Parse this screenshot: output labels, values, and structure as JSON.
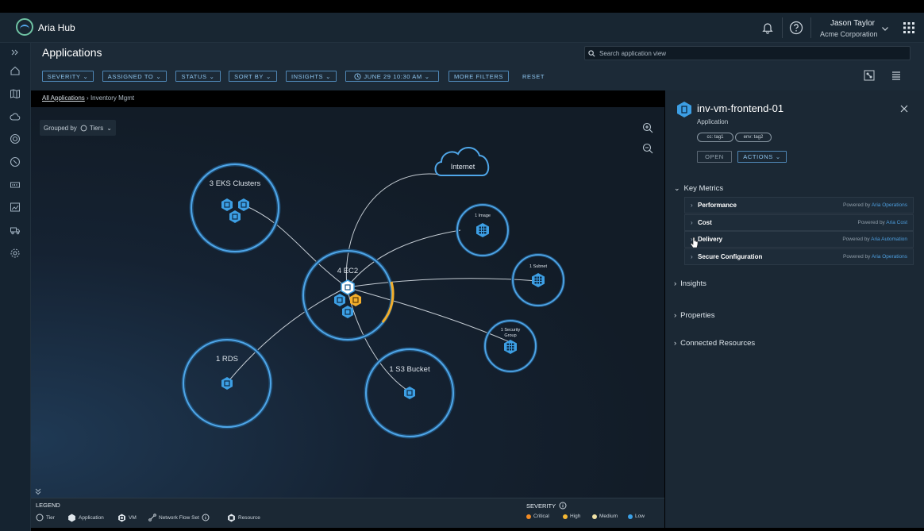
{
  "app": {
    "name": "Aria Hub"
  },
  "user": {
    "name": "Jason Taylor",
    "org": "Acme Corporation"
  },
  "header": {
    "title": "Applications",
    "search_placeholder": "Search application view",
    "filters": [
      "SEVERITY",
      "ASSIGNED TO",
      "STATUS",
      "SORT BY",
      "INSIGHTS",
      "JUNE 29 10:30 AM",
      "MORE FILTERS"
    ],
    "reset": "RESET"
  },
  "breadcrumb": {
    "root": "All Applications",
    "sep": "›",
    "current": "Inventory Mgmt"
  },
  "canvas": {
    "grouped_prefix": "Grouped by",
    "grouped_value": "Tiers",
    "nodes": {
      "eks": "3 EKS Clusters",
      "ec2": "4 EC2",
      "rds": "1 RDS",
      "s3": "1 S3 Bucket",
      "internet": "Internet",
      "image": "1 Image",
      "subnet": "1 Subnet",
      "sg_line1": "1 Security",
      "sg_line2": "Group"
    }
  },
  "legend": {
    "title": "LEGEND",
    "items": [
      "Tier",
      "Application",
      "VM",
      "Network Flow Set",
      "Resource"
    ],
    "severity_title": "SEVERITY",
    "severity": [
      {
        "label": "Critical",
        "color": "#f08a24"
      },
      {
        "label": "High",
        "color": "#f4b733"
      },
      {
        "label": "Medium",
        "color": "#f0e2a6"
      },
      {
        "label": "Low",
        "color": "#3aa0e6"
      }
    ]
  },
  "panel": {
    "title": "inv-vm-frontend-01",
    "subtitle": "Application",
    "tags": [
      "cc: tag1",
      "env: tag2"
    ],
    "open": "OPEN",
    "actions": "ACTIONS",
    "key_metrics": "Key Metrics",
    "metrics": [
      {
        "label": "Performance",
        "powered": "Powered by",
        "source": "Aria Operations"
      },
      {
        "label": "Cost",
        "powered": "Powered by",
        "source": "Aria Cost"
      },
      {
        "label": "Delivery",
        "powered": "Powered by",
        "source": "Aria Automation"
      },
      {
        "label": "Secure Configuration",
        "powered": "Powered by",
        "source": "Aria Operations"
      }
    ],
    "sections": [
      "Insights",
      "Properties",
      "Connected Resources"
    ]
  },
  "colors": {
    "accent": "#4fa6e8",
    "node_ring": "#3d9ee6",
    "warning": "#f3ae2b",
    "critical": "#f08a24"
  }
}
